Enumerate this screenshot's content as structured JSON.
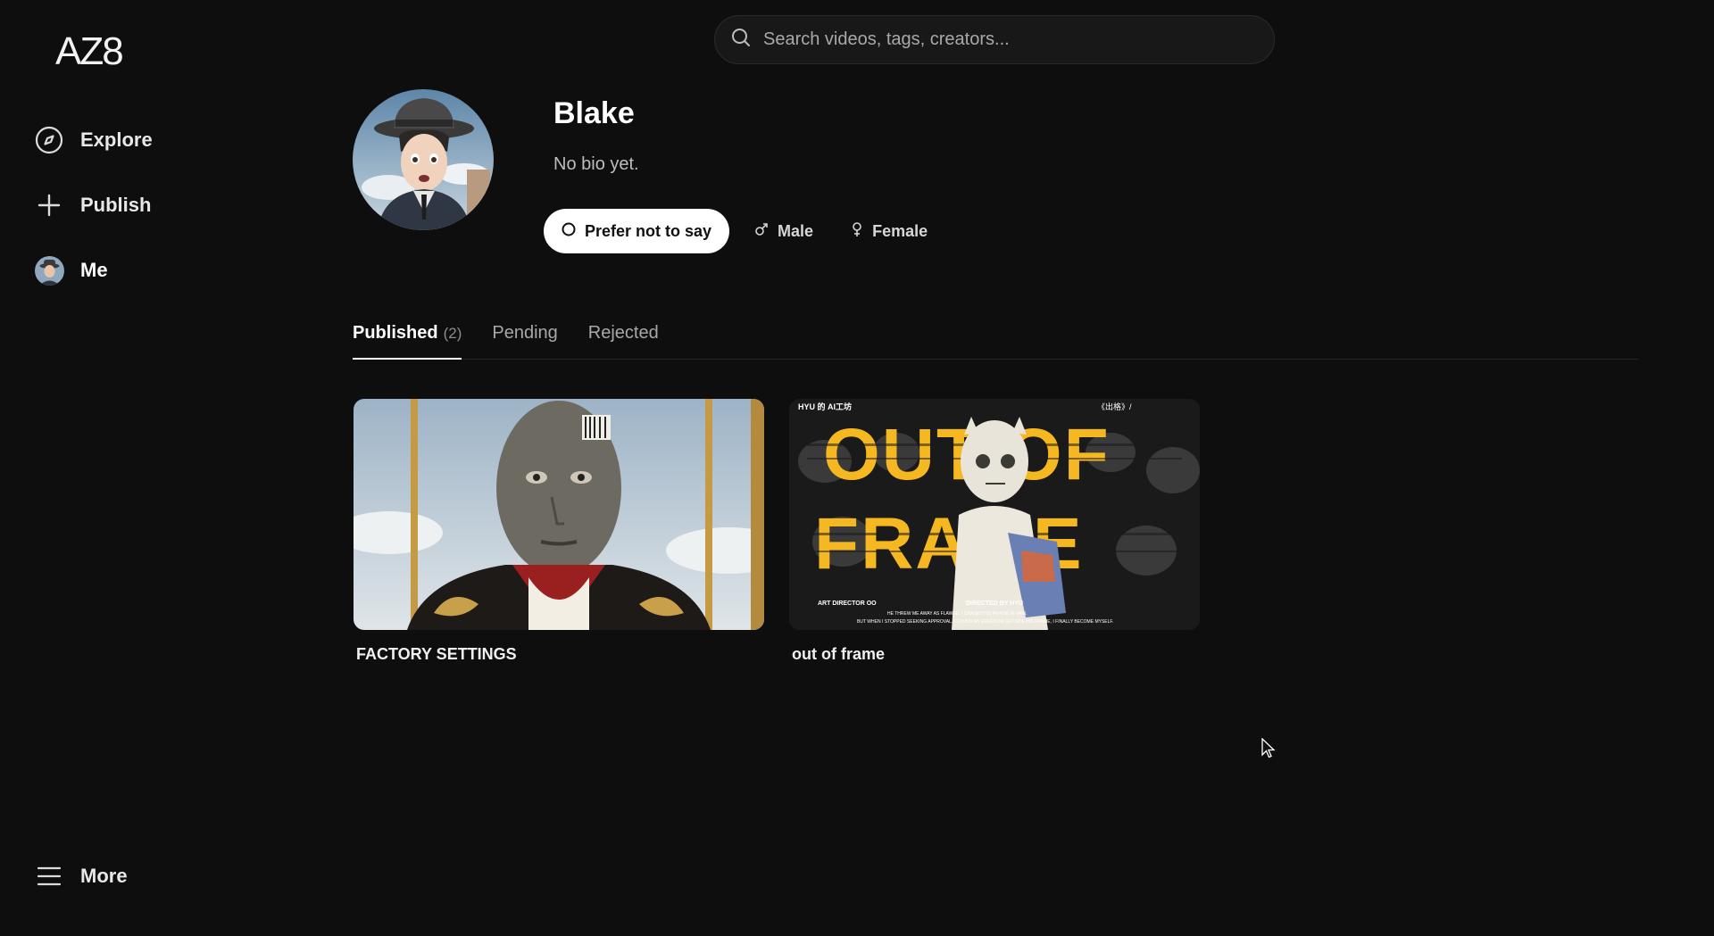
{
  "app": {
    "logo_text": "AZ8"
  },
  "sidebar": {
    "items": [
      {
        "label": "Explore",
        "icon": "compass-icon"
      },
      {
        "label": "Publish",
        "icon": "plus-icon"
      },
      {
        "label": "Me",
        "icon": "avatar"
      }
    ],
    "more_label": "More"
  },
  "search": {
    "placeholder": "Search videos, tags, creators..."
  },
  "profile": {
    "name": "Blake",
    "bio": "No bio yet.",
    "gender_options": [
      {
        "label": "Prefer not to say",
        "icon": "circle-icon",
        "selected": true
      },
      {
        "label": "Male",
        "icon": "male-icon",
        "selected": false
      },
      {
        "label": "Female",
        "icon": "female-icon",
        "selected": false
      }
    ]
  },
  "tabs": [
    {
      "label": "Published",
      "count": "(2)",
      "active": true
    },
    {
      "label": "Pending",
      "count": "",
      "active": false
    },
    {
      "label": "Rejected",
      "count": "",
      "active": false
    }
  ],
  "videos": [
    {
      "title": "FACTORY SETTINGS"
    },
    {
      "title": "out of frame",
      "thumb_text": {
        "top_left": "HYU 的 AI工坊",
        "top_right": "《出格》/",
        "headline_1": "OUT OF",
        "headline_2": "FRAME",
        "credit_left": "ART DIRECTOR OO",
        "credit_right": "DIRECTED BY HYU",
        "tagline_1": "HE THREW ME AWAY AS FLAWED, I CHASED HIS PRAISE IN VAIN.",
        "tagline_2": "BUT WHEN I STOPPED SEEKING APPROVAL, I FOUND MY FREEDOM.OUTSIDE HIS FRAME, I FINALLY BECOME MYSELF."
      }
    }
  ],
  "colors": {
    "background": "#0e0e0e",
    "accent_yellow": "#f5b820"
  }
}
